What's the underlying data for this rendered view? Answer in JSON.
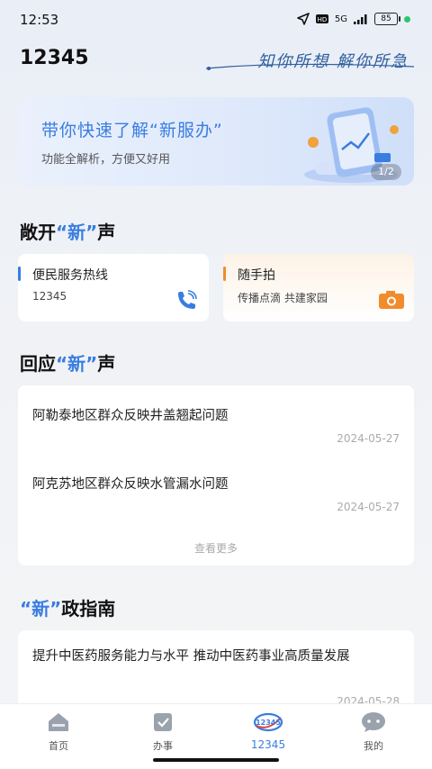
{
  "status": {
    "time": "12:53",
    "network": "5G",
    "battery": "85"
  },
  "header": {
    "title": "12345",
    "slogan": "知你所想 解你所急"
  },
  "banner": {
    "title": "带你快速了解“新服办”",
    "subtitle": "功能全解析，方便又好用",
    "pager": "1/2"
  },
  "section1": {
    "pre": "敞开",
    "quote": "“新”",
    "post": "声"
  },
  "hotline": {
    "title": "便民服务热线",
    "number": "12345",
    "icon": "phone-icon"
  },
  "snapshot": {
    "title": "随手拍",
    "subtitle": "传播点滴  共建家园",
    "icon": "camera-icon"
  },
  "section2": {
    "pre": "回应",
    "quote": "“新”",
    "post": "声"
  },
  "responses": [
    {
      "title": "阿勒泰地区群众反映井盖翘起问题",
      "date": "2024-05-27"
    },
    {
      "title": "阿克苏地区群众反映水管漏水问题",
      "date": "2024-05-27"
    }
  ],
  "more_label": "查看更多",
  "section3": {
    "quote": "“新”",
    "post": "政指南"
  },
  "guide": {
    "title": "提升中医药服务能力与水平 推动中医药事业高质量发展",
    "date": "2024-05-28"
  },
  "tabs": [
    {
      "label": "首页",
      "icon": "home-icon"
    },
    {
      "label": "办事",
      "icon": "clipboard-check-icon"
    },
    {
      "label": "12345",
      "icon": "12345-logo-icon"
    },
    {
      "label": "我的",
      "icon": "chat-bubble-icon"
    }
  ],
  "colors": {
    "accent": "#3a7de0",
    "hotline_bar": "#3a7de0",
    "snapshot_bar": "#f08c2b"
  }
}
